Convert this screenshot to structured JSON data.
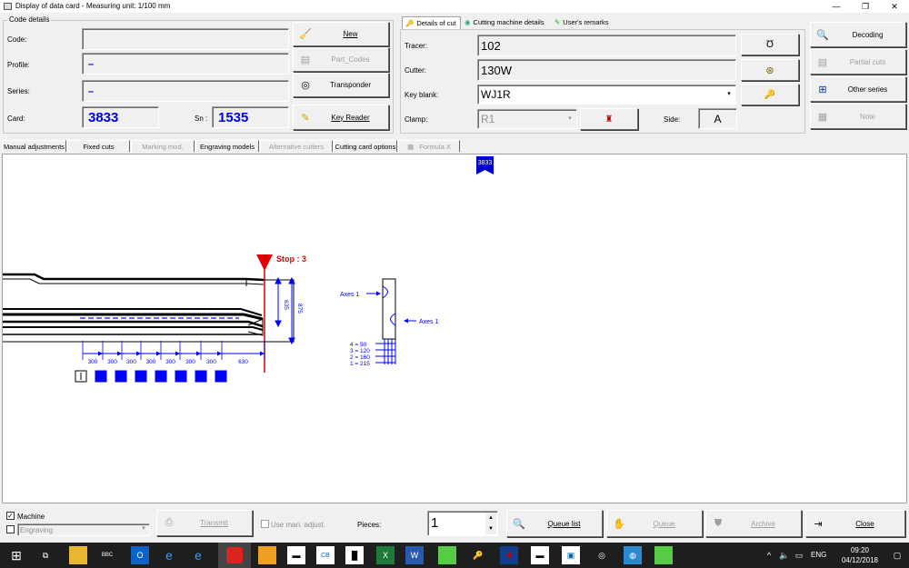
{
  "window": {
    "title": "Display of data card - Measuring unit: 1/100 mm",
    "minimize": "—",
    "restore": "❐",
    "close": "✕"
  },
  "code_details": {
    "group_label": "Code details",
    "code_label": "Code:",
    "code_value": "",
    "profile_label": "Profile:",
    "profile_value": "–",
    "series_label": "Series:",
    "series_value": "–",
    "card_label": "Card:",
    "card_value": "3833",
    "sn_label": "Sn :",
    "sn_value": "1535"
  },
  "left_buttons": {
    "new": "New",
    "part_codes": "Part_Codes",
    "transponder": "Transponder",
    "key_reader": "Key Reader"
  },
  "panel_tabs": {
    "details_of_cut": "Details of cut",
    "cutting_machine_details": "Cutting machine details",
    "users_remarks": "User's remarks"
  },
  "details": {
    "tracer_label": "Tracer:",
    "tracer_value": "102",
    "cutter_label": "Cutter:",
    "cutter_value": "130W",
    "key_blank_label": "Key blank:",
    "key_blank_value": "WJ1R",
    "clamp_label": "Clamp:",
    "clamp_value": "R1",
    "side_label": "Side:",
    "side_value": "A"
  },
  "right_buttons": {
    "decoding": "Decoding",
    "partial_cuts": "Partial cuts",
    "other_series": "Other series",
    "note": "Note"
  },
  "view_tabs": [
    "Manual adjustments",
    "Fixed cuts",
    "Marking mod.",
    "Engraving models",
    "Alternative cutters",
    "Cutting card options",
    "Formula X"
  ],
  "drawing": {
    "card_flag": "3833",
    "stop_label": "Stop : 3",
    "dim_635": "635",
    "dim_875": "875",
    "spacings": [
      "300",
      "300",
      "300",
      "300",
      "300",
      "300",
      "300",
      "630"
    ],
    "axes_left": "Axes 1",
    "axes_right": "Axes 1",
    "depths": [
      "4 = 50",
      "3 = 120",
      "2 = 160",
      "1 = 215"
    ],
    "cut_count": 8,
    "cut_color": "#0000ff",
    "stop_color": "#e00000"
  },
  "bottom": {
    "machine_label": "Machine",
    "engraving_label": "Engraving",
    "transmit": "Transmit",
    "use_man_adjust": "Use man. adjust.",
    "pieces_label": "Pieces:",
    "pieces_value": "1",
    "queue_list": "Queue list",
    "queue": "Queue",
    "archive": "Archive",
    "close": "Close"
  },
  "taskbar": {
    "lang": "ENG",
    "time": "09:20",
    "date": "04/12/2018"
  }
}
